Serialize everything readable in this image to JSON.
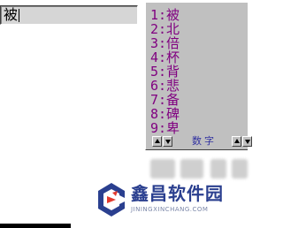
{
  "input": {
    "composition_text": "被"
  },
  "candidates": {
    "items": [
      {
        "label": "1:被"
      },
      {
        "label": "2:北"
      },
      {
        "label": "3:倍"
      },
      {
        "label": "4:杯"
      },
      {
        "label": "5:背"
      },
      {
        "label": "6:悲"
      },
      {
        "label": "7:备"
      },
      {
        "label": "8:碑"
      },
      {
        "label": "9:卑"
      }
    ],
    "mode_label": "数字",
    "item_color": "#800080"
  },
  "watermark": {
    "name": "鑫昌软件园",
    "url": "JININGXINCHANG.COM"
  }
}
